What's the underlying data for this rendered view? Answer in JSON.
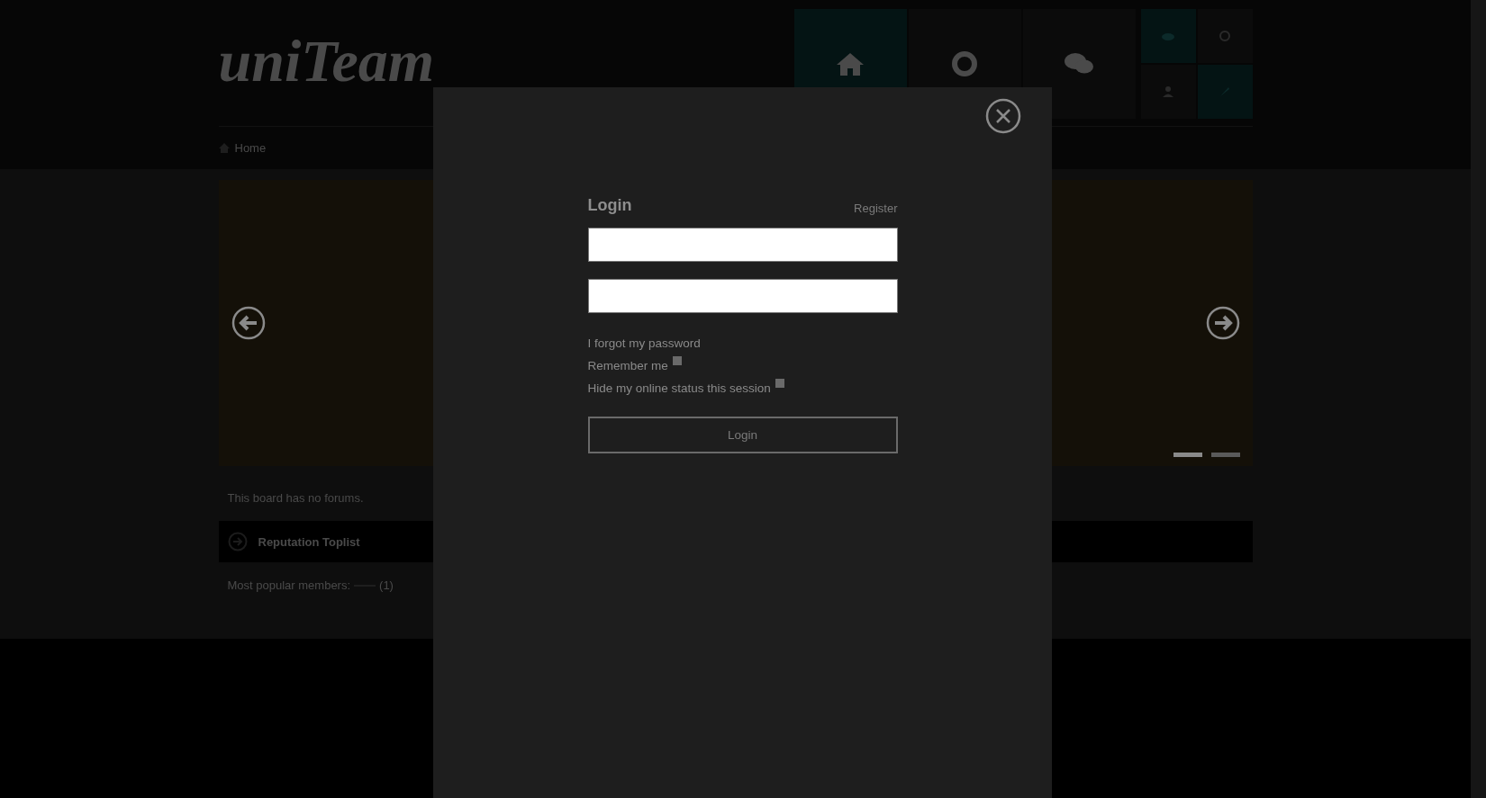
{
  "header": {
    "logo": "uniTeam",
    "breadcrumb": "Home"
  },
  "slider": {
    "dots": [
      {
        "selected": true
      },
      {
        "selected": false
      }
    ]
  },
  "content": {
    "notice": "This board has no forums.",
    "section_title": "Reputation Toplist",
    "members_label": "Most popular members:",
    "members_count": "(1)"
  },
  "login_modal": {
    "title": "Login",
    "register_link": "Register",
    "forgot_link": "I forgot my password",
    "options": [
      {
        "label": "Remember me",
        "checked": false
      },
      {
        "label": "Hide my online status this session",
        "checked": false
      }
    ],
    "submit": "Login"
  }
}
